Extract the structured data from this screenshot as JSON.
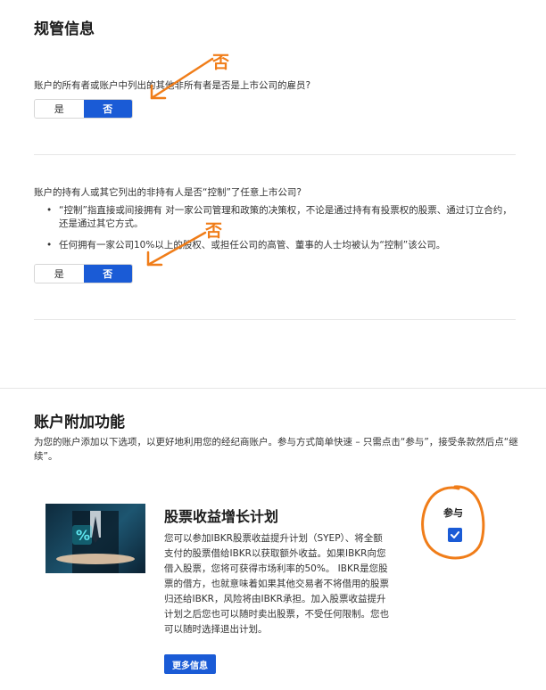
{
  "regulatory": {
    "title": "规管信息",
    "q1": {
      "text": "账户的所有者或账户中列出的其他非所有者是否是上市公司的雇员?",
      "yes_label": "是",
      "no_label": "否",
      "selected": "否"
    },
    "q2": {
      "text": "账户的持有人或其它列出的非持有人是否“控制”了任意上市公司?",
      "bullets": [
        "“控制”指直接或间接拥有 对一家公司管理和政策的决策权，不论是通过持有有投票权的股票、通过订立合约，还是通过其它方式。",
        "任何拥有一家公司10%以上的股权、或担任公司的高管、董事的人士均被认为“控制”该公司。"
      ],
      "yes_label": "是",
      "no_label": "否",
      "selected": "否"
    }
  },
  "annotations": {
    "a1": "否",
    "a2": "否",
    "color": "#f07d19"
  },
  "addons": {
    "title": "账户附加功能",
    "description": "为您的账户添加以下选项，以更好地利用您的经纪商账户。参与方式简单快速 – 只需点击“参与”，接受条款然后点“继续”。",
    "product": {
      "title": "股票收益增长计划",
      "description": "您可以参加IBKR股票收益提升计划（SYEP）、将全额支付的股票借给IBKR以获取额外收益。如果IBKR向您借入股票，您将可获得市场利率的50%。 IBKR是您股票的借方，也就意味着如果其他交易者不将借用的股票归还给IBKR，风险将由IBKR承担。加入股票收益提升计划之后您也可以随时卖出股票，不受任何限制。您也可以随时选择退出计划。",
      "more_button": "更多信息",
      "participate_label": "参与",
      "participate_checked": true,
      "image_glyph": "%"
    }
  },
  "colors": {
    "accent": "#1a5bd6",
    "annotation": "#f07d19"
  }
}
